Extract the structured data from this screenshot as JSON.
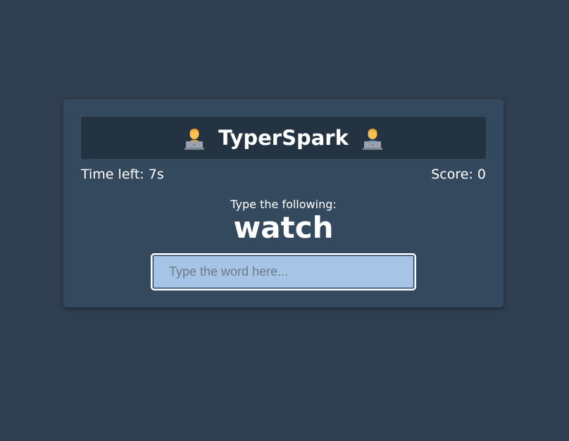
{
  "app": {
    "title": "TyperSpark",
    "title_icon": "technologist-emoji"
  },
  "stats": {
    "time_left": "Time left: 7s",
    "score": "Score: 0"
  },
  "game": {
    "prompt_label": "Type the following:",
    "current_word": "watch"
  },
  "input": {
    "placeholder": "Type the word here...",
    "value": ""
  },
  "colors": {
    "page_background": "#2f3e50",
    "card_background": "#35495e",
    "header_background": "#243342",
    "input_background": "#a6c4e5",
    "text": "#ffffff"
  }
}
